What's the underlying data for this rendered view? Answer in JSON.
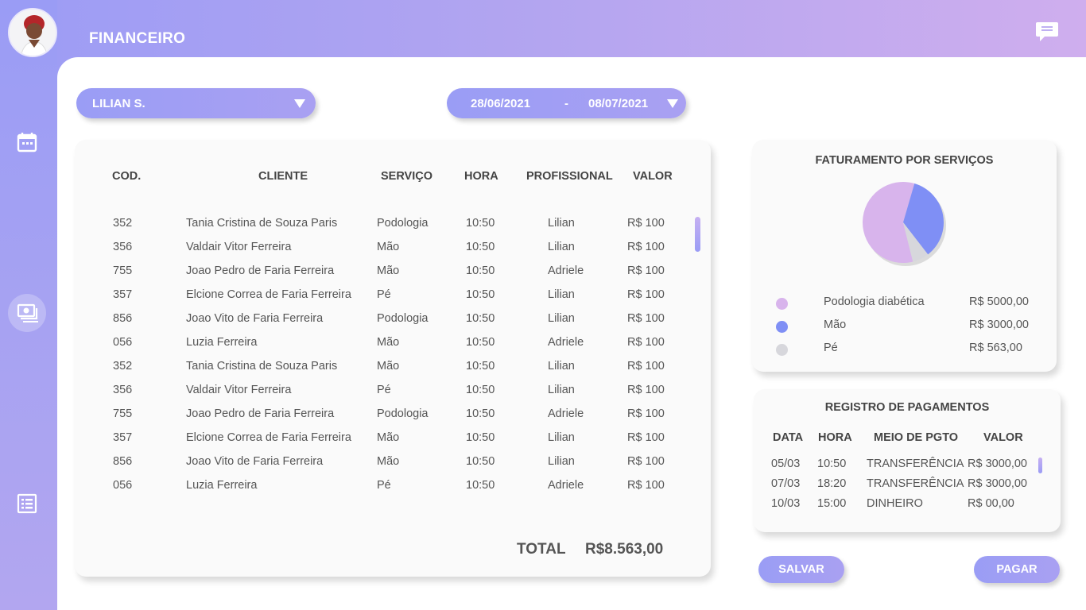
{
  "header": {
    "title": "FINANCEIRO"
  },
  "sidebar": {
    "items": [
      {
        "icon": "calendar-icon"
      },
      {
        "icon": "money-icon"
      },
      {
        "icon": "list-icon"
      }
    ]
  },
  "filters": {
    "professional": "LILIAN S.",
    "date_start": "28/06/2021",
    "date_separator": "-",
    "date_end": "08/07/2021"
  },
  "table": {
    "headers": [
      "COD.",
      "CLIENTE",
      "SERVIÇO",
      "HORA",
      "PROFISSIONAL",
      "VALOR"
    ],
    "rows": [
      [
        "352",
        "Tania Cristina de Souza Paris",
        "Podologia",
        "10:50",
        "Lilian",
        "R$ 100"
      ],
      [
        "356",
        "Valdair Vitor Ferreira",
        "Mão",
        "10:50",
        "Lilian",
        "R$ 100"
      ],
      [
        "755",
        "Joao Pedro de Faria Ferreira",
        "Mão",
        "10:50",
        "Adriele",
        "R$ 100"
      ],
      [
        "357",
        "Elcione Correa de Faria Ferreira",
        "Pé",
        "10:50",
        "Lilian",
        "R$ 100"
      ],
      [
        "856",
        "Joao Vito de Faria Ferreira",
        "Podologia",
        "10:50",
        "Lilian",
        "R$ 100"
      ],
      [
        "056",
        "Luzia Ferreira",
        "Mão",
        "10:50",
        "Adriele",
        "R$ 100"
      ],
      [
        "352",
        "Tania Cristina de Souza Paris",
        "Mão",
        "10:50",
        "Lilian",
        "R$ 100"
      ],
      [
        "356",
        "Valdair Vitor Ferreira",
        "Pé",
        "10:50",
        "Lilian",
        "R$ 100"
      ],
      [
        "755",
        "Joao Pedro de Faria Ferreira",
        "Podologia",
        "10:50",
        "Adriele",
        "R$ 100"
      ],
      [
        "357",
        "Elcione Correa de Faria Ferreira",
        "Mão",
        "10:50",
        "Lilian",
        "R$ 100"
      ],
      [
        "856",
        "Joao Vito de Faria Ferreira",
        "Mão",
        "10:50",
        "Lilian",
        "R$ 100"
      ],
      [
        "056",
        "Luzia Ferreira",
        "Pé",
        "10:50",
        "Adriele",
        "R$ 100"
      ]
    ],
    "total_label": "TOTAL",
    "total_value": "R$8.563,00"
  },
  "revenue": {
    "title": "FATURAMENTO POR SERVIÇOS",
    "chart_data": {
      "type": "pie",
      "categories": [
        "Podologia diabética",
        "Mão",
        "Pé"
      ],
      "values": [
        5000,
        3000,
        563
      ],
      "colors": [
        "#d8b4ec",
        "#7f8ff5",
        "#d7d7dc"
      ]
    },
    "legend": [
      {
        "name": "Podologia diabética",
        "value": "R$ 5000,00",
        "color": "#d8b4ec"
      },
      {
        "name": "Mão",
        "value": "R$ 3000,00",
        "color": "#7f8ff5"
      },
      {
        "name": "Pé",
        "value": "R$ 563,00",
        "color": "#d7d7dc"
      }
    ]
  },
  "payments": {
    "title": "REGISTRO DE PAGAMENTOS",
    "headers": [
      "DATA",
      "HORA",
      "MEIO DE PGTO",
      "VALOR"
    ],
    "rows": [
      [
        "05/03",
        "10:50",
        "TRANSFERÊNCIA",
        "R$ 3000,00"
      ],
      [
        "07/03",
        "18:20",
        "TRANSFERÊNCIA",
        "R$ 3000,00"
      ],
      [
        "10/03",
        "15:00",
        "DINHEIRO",
        "R$ 00,00"
      ]
    ]
  },
  "actions": {
    "save_label": "SALVAR",
    "pay_label": "PAGAR"
  }
}
